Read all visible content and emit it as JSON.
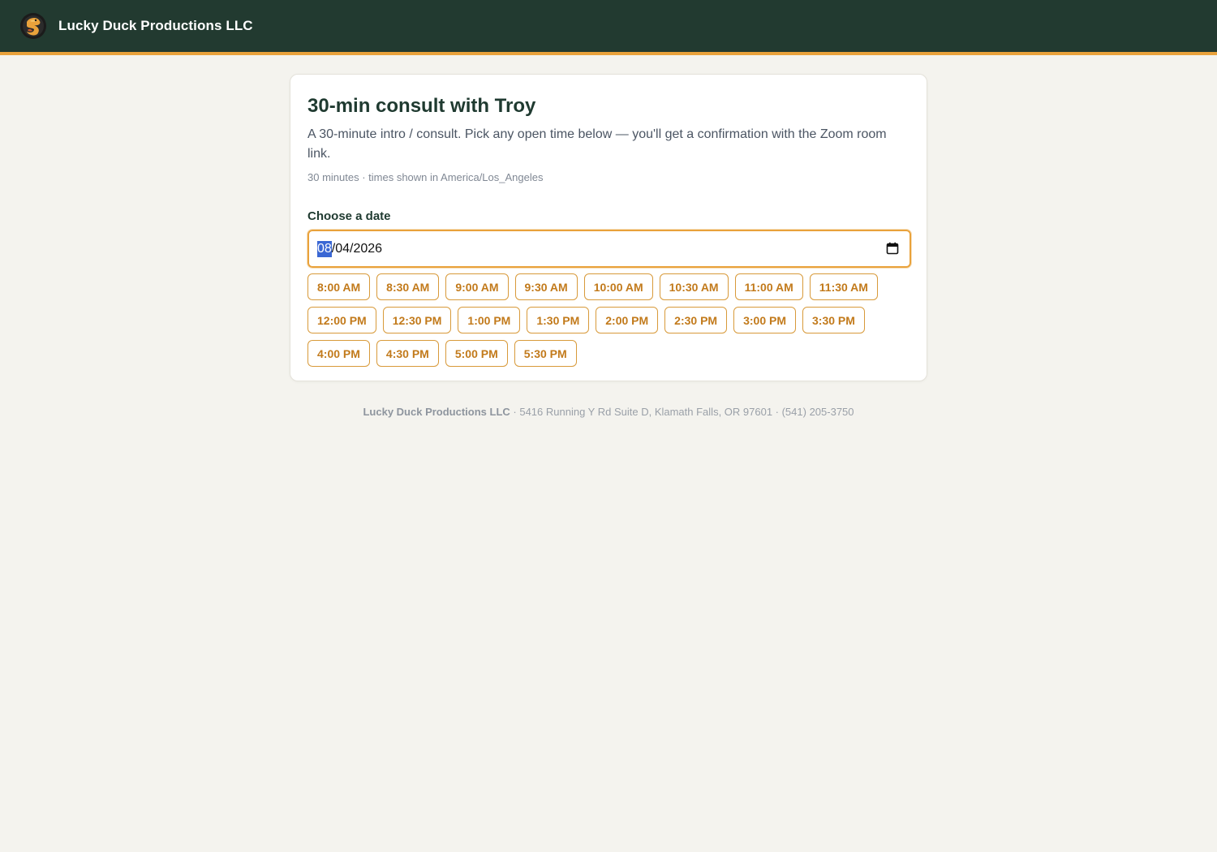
{
  "header": {
    "brand": "Lucky Duck Productions LLC",
    "logo_icon": "duck-logo-icon",
    "bg_color": "#223a30",
    "accent_color": "#e9a23b"
  },
  "event": {
    "title": "30-min consult with Troy",
    "description": "A 30-minute intro / consult. Pick any open time below — you'll get a confirmation with the Zoom room link.",
    "meta": "30 minutes · times shown in America/Los_Angeles"
  },
  "date_picker": {
    "label": "Choose a date",
    "month": "08",
    "rest": "/04/2026",
    "icon": "calendar-icon"
  },
  "slots": [
    "8:00 AM",
    "8:30 AM",
    "9:00 AM",
    "9:30 AM",
    "10:00 AM",
    "10:30 AM",
    "11:00 AM",
    "11:30 AM",
    "12:00 PM",
    "12:30 PM",
    "1:00 PM",
    "1:30 PM",
    "2:00 PM",
    "2:30 PM",
    "3:00 PM",
    "3:30 PM",
    "4:00 PM",
    "4:30 PM",
    "5:00 PM",
    "5:30 PM"
  ],
  "footer": {
    "company": "Lucky Duck Productions LLC",
    "details": " · 5416 Running Y Rd Suite D, Klamath Falls, OR 97601 · (541) 205-3750"
  }
}
